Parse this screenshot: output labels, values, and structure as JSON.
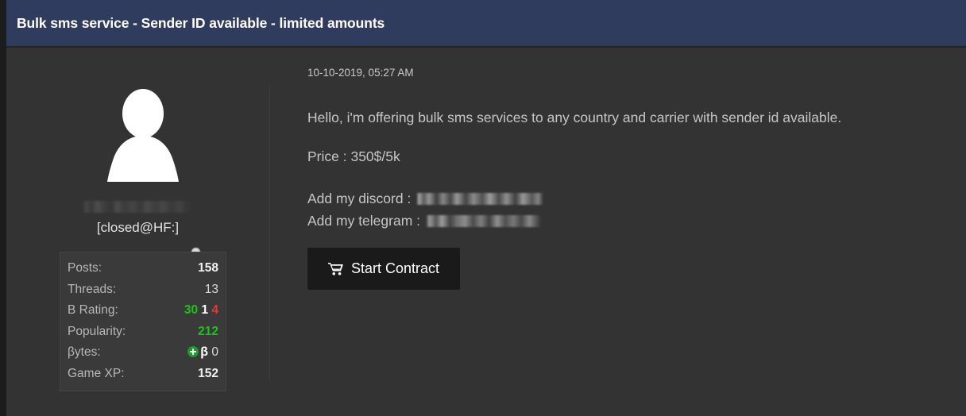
{
  "thread": {
    "title": "Bulk sms service - Sender ID available - limited amounts"
  },
  "author": {
    "avatar_icon": "default-user-silhouette-icon",
    "username": "",
    "username_redacted": true,
    "status_indicator": "online-status-dot",
    "usertitle": "[closed@HF:]",
    "stats": [
      {
        "label": "Posts:",
        "value": "158",
        "style": "bold"
      },
      {
        "label": "Threads:",
        "value": "13",
        "style": "plain"
      },
      {
        "label": "B Rating:",
        "value": "30 1 4",
        "style": "rating",
        "rating": {
          "positive": "30",
          "neutral": "1",
          "negative": "4"
        }
      },
      {
        "label": "Popularity:",
        "value": "212",
        "style": "green"
      },
      {
        "label": "βytes:",
        "value": "0",
        "style": "bytes",
        "bytes": {
          "icon": "plus-circle-icon",
          "symbol": "β",
          "amount": "0"
        }
      },
      {
        "label": "Game XP:",
        "value": "152",
        "style": "bold"
      }
    ]
  },
  "post": {
    "date": "10-10-2019, 05:27 AM",
    "paragraphs": [
      "Hello, i'm offering bulk sms services to any country and carrier with sender id available.",
      "Price : 350$/5k"
    ],
    "contacts": [
      {
        "label": "Add my discord :",
        "handle": "",
        "redacted": true
      },
      {
        "label": "Add my telegram :",
        "handle": "",
        "redacted": true
      }
    ],
    "contract_button": {
      "label": "Start Contract",
      "icon": "shopping-cart-icon"
    }
  },
  "colors": {
    "header_bar": "#303c5e",
    "page_background": "#333333",
    "outer_background": "#1c1c1c",
    "stats_box": "#3a3a3a",
    "button": "#1a1a1a",
    "positive_green": "#18c518",
    "negative_red": "#ef3434",
    "neutral_white": "#ffffff",
    "body_text": "#c6c6c6"
  }
}
